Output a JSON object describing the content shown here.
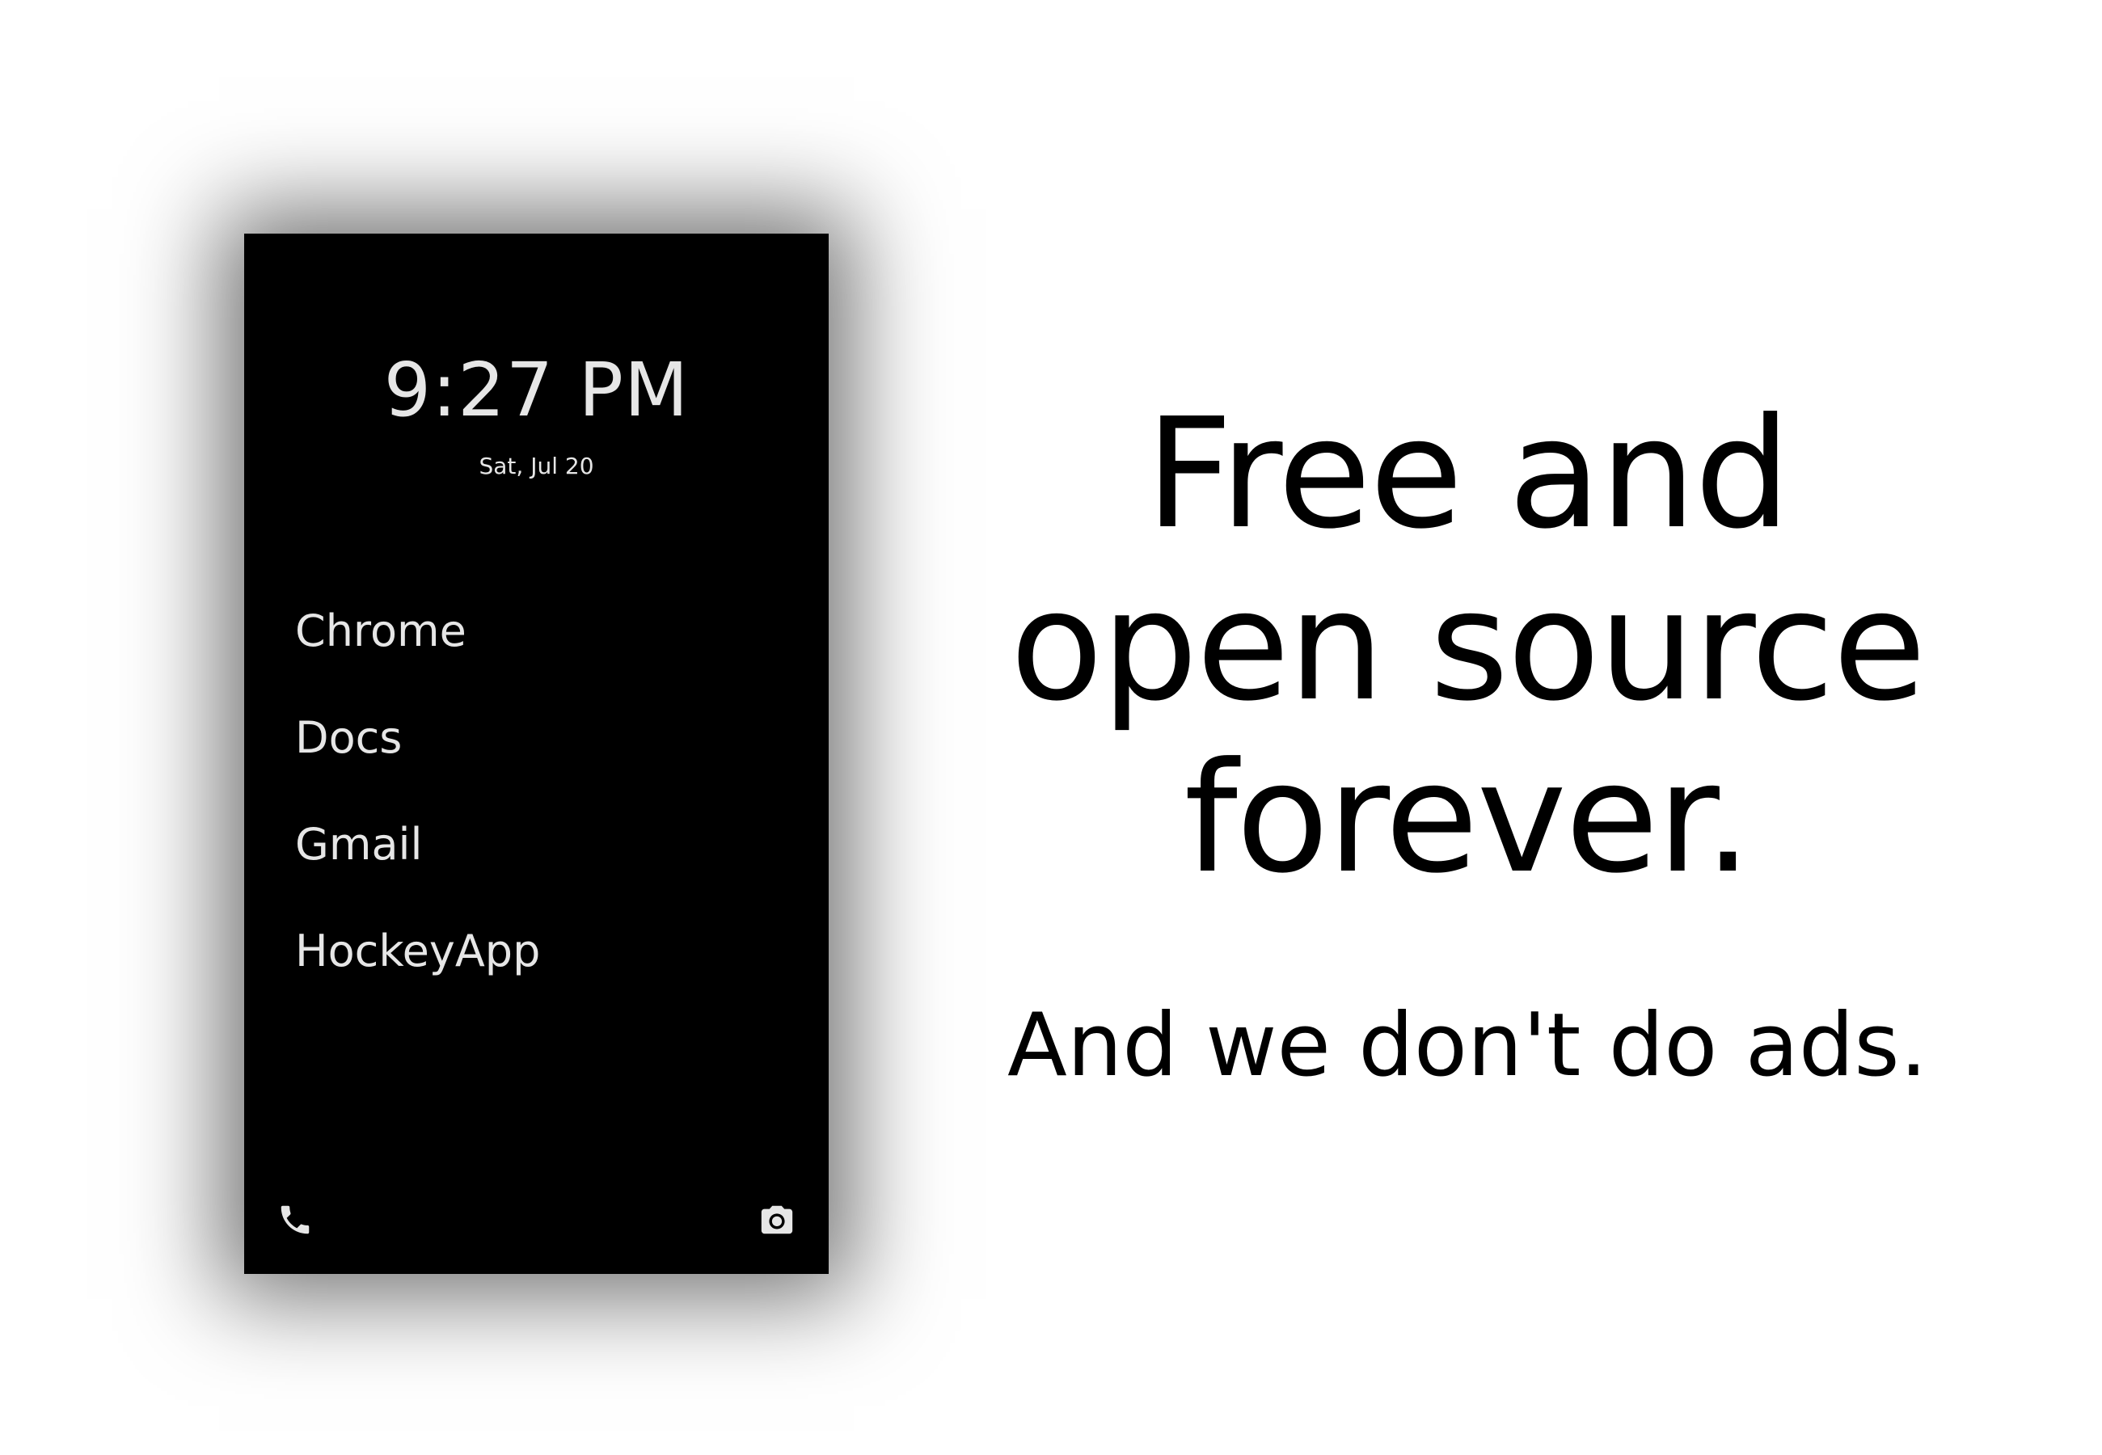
{
  "lockscreen": {
    "time": "9:27 PM",
    "date": "Sat, Jul 20",
    "apps": [
      {
        "label": "Chrome"
      },
      {
        "label": "Docs"
      },
      {
        "label": "Gmail"
      },
      {
        "label": "HockeyApp"
      }
    ],
    "shortcuts": {
      "left_icon": "phone-icon",
      "right_icon": "camera-icon"
    },
    "colors": {
      "screen_background": "#000000",
      "text": "#e6e6e6"
    }
  },
  "tagline": {
    "headline_lines": [
      "Free and",
      "open source",
      "forever."
    ],
    "subline": "And we don't do ads."
  }
}
